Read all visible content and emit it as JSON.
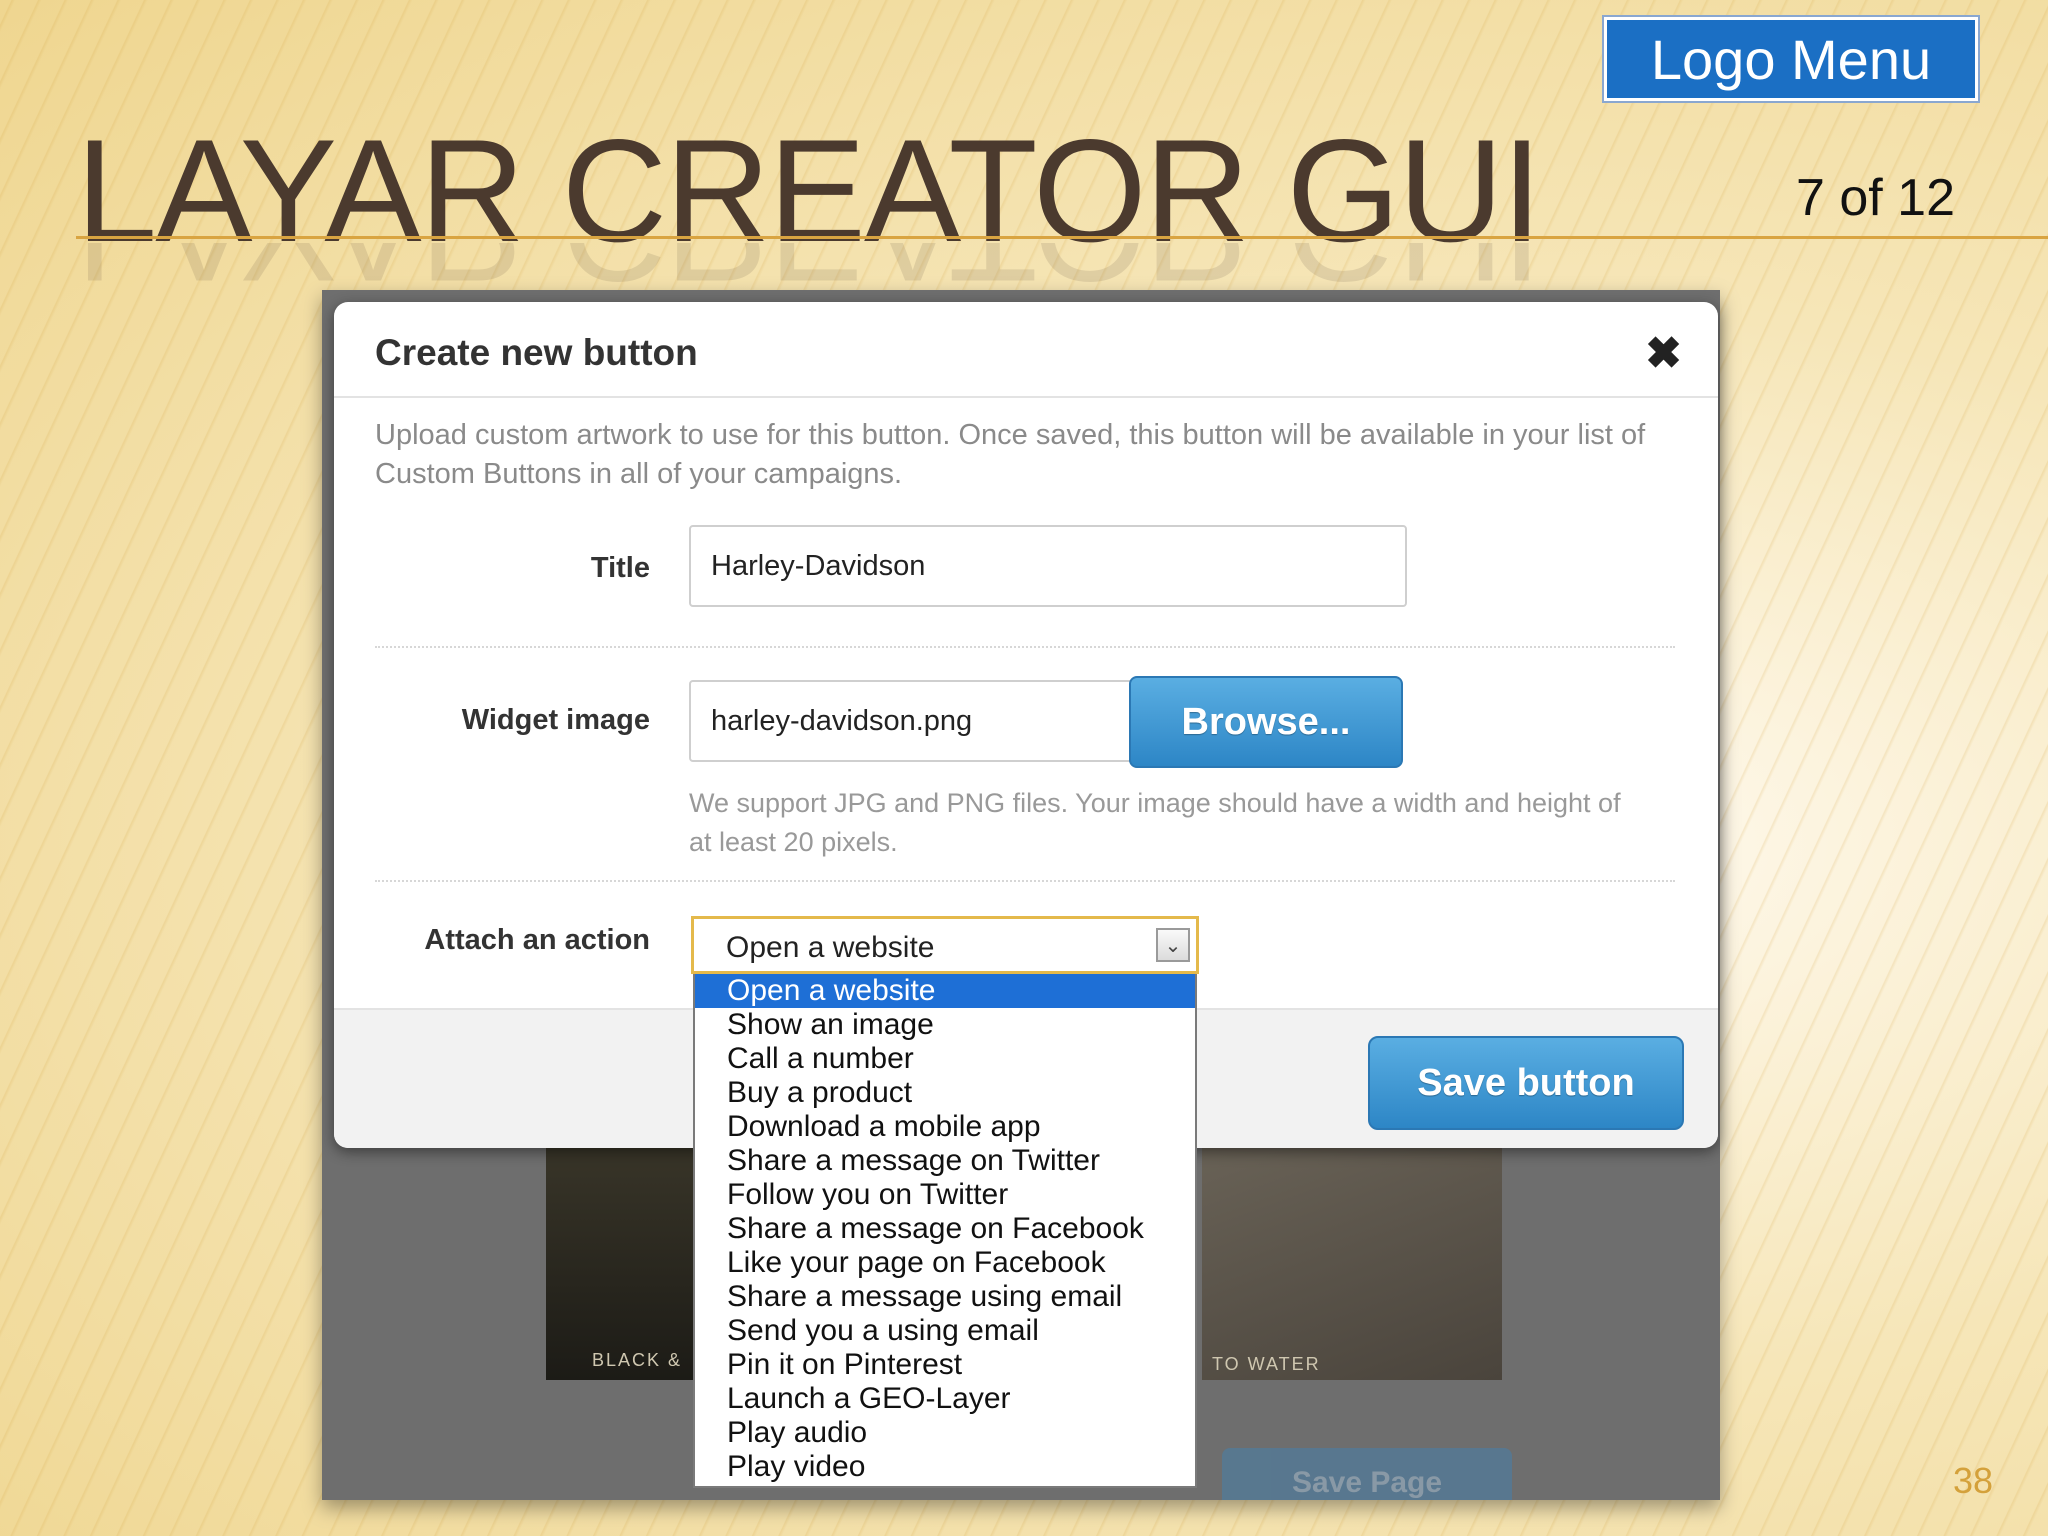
{
  "slide": {
    "title": "LAYAR CREATOR GUI",
    "logo_menu": "Logo Menu",
    "counter": "7 of 12",
    "page_number": "38"
  },
  "background": {
    "text_left": "BLACK &",
    "text_right": "TO WATER",
    "save_page": "Save Page"
  },
  "modal": {
    "title": "Create new button",
    "close": "✖",
    "description": "Upload custom artwork to use for this button. Once saved, this button will be available in your list of Custom Buttons in all of your campaigns.",
    "title_label": "Title",
    "title_value": "Harley-Davidson",
    "widget_label": "Widget image",
    "widget_value": "harley-davidson.png",
    "browse_label": "Browse...",
    "hint": "We support JPG and PNG files. Your image should have a width and height of at least 20 pixels.",
    "action_label": "Attach an action",
    "action_selected": "Open a website",
    "save_label": "Save button",
    "options": [
      "Open a website",
      "Show an image",
      "Call a number",
      "Buy a product",
      "Download a mobile app",
      "Share a message on Twitter",
      "Follow you on Twitter",
      "Share a message on Facebook",
      "Like your page on Facebook",
      "Share a message using email",
      "Send you a using email",
      "Pin it on Pinterest",
      "Launch a GEO-Layer",
      "Play audio",
      "Play video"
    ]
  }
}
